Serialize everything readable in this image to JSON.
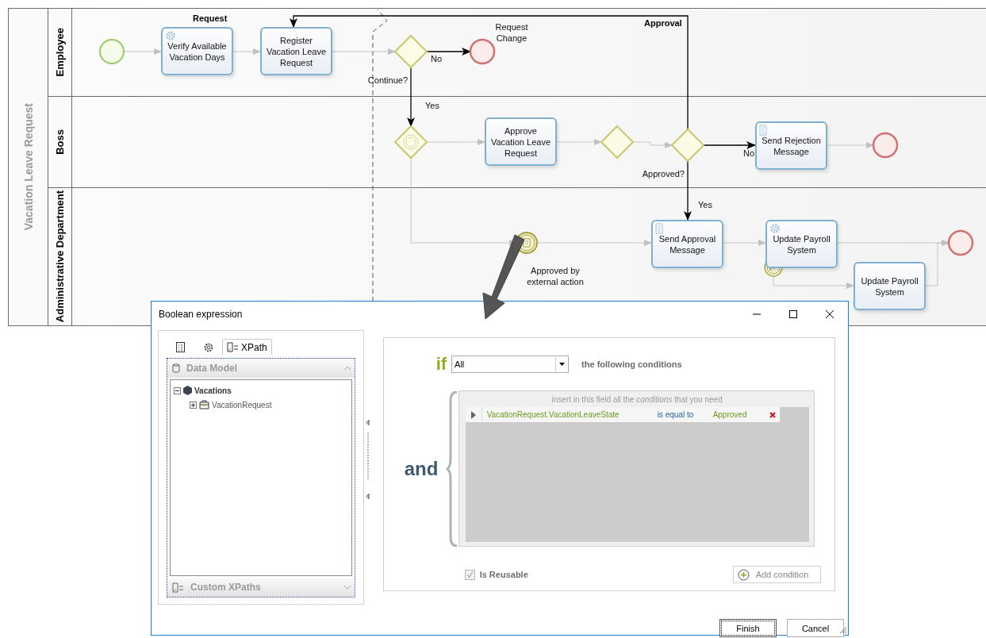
{
  "pool": {
    "title": "Vacation Leave Request",
    "lanes": [
      "Employee",
      "Boss",
      "Administrative Department"
    ],
    "phases": [
      "Request",
      "Approval"
    ]
  },
  "tasks": [
    {
      "label": "Verify Available Vacation Days",
      "kind": "service"
    },
    {
      "label": "Register Vacation Leave Request",
      "kind": "user"
    },
    {
      "label": "Approve Vacation Leave Request",
      "kind": "user"
    },
    {
      "label": "Send Rejection Message",
      "kind": "script"
    },
    {
      "label": "Send Approval Message",
      "kind": "script"
    },
    {
      "label": "Update Payroll System",
      "kind": "service"
    },
    {
      "label": "Update Payroll System",
      "kind": "user"
    }
  ],
  "gateways": [
    {
      "label": "Continue?",
      "kind": "exclusive"
    },
    {
      "kind": "event"
    },
    {
      "kind": "exclusive"
    },
    {
      "label": "Approved?",
      "kind": "exclusive"
    }
  ],
  "events": [
    {
      "kind": "start"
    },
    {
      "kind": "end",
      "label": "Request Change"
    },
    {
      "kind": "end"
    },
    {
      "kind": "intermediate",
      "label": "Approved by external action"
    },
    {
      "kind": "end"
    },
    {
      "kind": "boundary"
    }
  ],
  "flow_labels": [
    "No",
    "Yes",
    "No",
    "Yes"
  ],
  "dialog": {
    "title": "Boolean expression",
    "tabs": [
      {
        "kind": "table",
        "selected": false
      },
      {
        "kind": "gear",
        "selected": false
      },
      {
        "kind": "xpath",
        "label": "XPath",
        "selected": true
      }
    ],
    "sections": [
      {
        "label": "Data Model",
        "expanded": true
      },
      {
        "label": "Custom XPaths",
        "expanded": false
      }
    ],
    "tree": [
      {
        "label": "Vacations",
        "expanded": true,
        "children": [
          {
            "label": "VacationRequest",
            "expanded": false
          }
        ]
      }
    ],
    "if_word": "if",
    "quantifier": "All",
    "following": "the following conditions",
    "and_word": "and",
    "hint": "insert in this field all the *conditions* that you need",
    "conditions": [
      {
        "field": "VacationRequest.VacationLeaveState",
        "operator": "is equal to",
        "value": "Approved"
      }
    ],
    "reusable": {
      "label": "Is Reusable",
      "checked": true,
      "disabled": true
    },
    "add_label": "Add condition",
    "buttons": [
      {
        "label": "Finish",
        "focused": true
      },
      {
        "label": "Cancel",
        "focused": false
      }
    ]
  }
}
